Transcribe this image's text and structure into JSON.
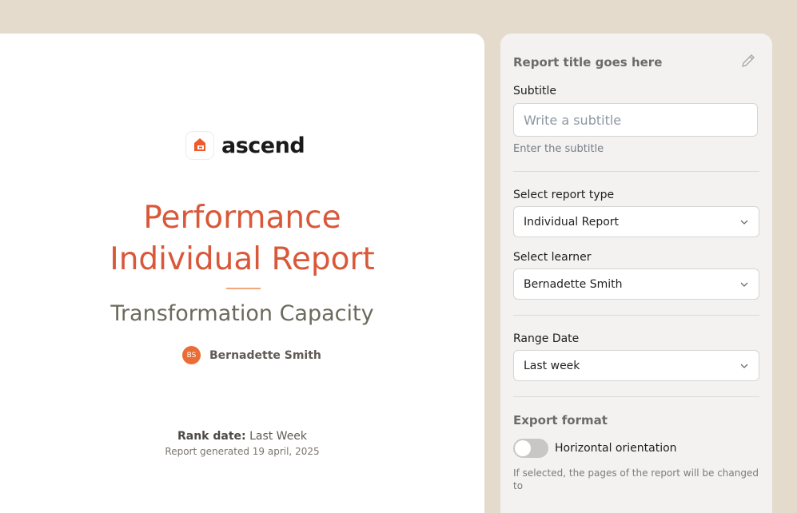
{
  "preview": {
    "logo_text": "ascend",
    "title_line1": "Performance",
    "title_line2": "Individual Report",
    "subject": "Transformation Capacity",
    "learner_initials": "BS",
    "learner_name": "Bernadette Smith",
    "rank_label": "Rank date:",
    "rank_value": "Last Week",
    "generated": "Report generated 19 april, 2025"
  },
  "panel": {
    "title": "Report title goes here",
    "subtitle_label": "Subtitle",
    "subtitle_placeholder": "Write a subtitle",
    "subtitle_helper": "Enter the subtitle",
    "report_type_label": "Select report type",
    "report_type_value": "Individual Report",
    "learner_label": "Select learner",
    "learner_value": "Bernadette Smith",
    "range_label": "Range Date",
    "range_value": "Last week",
    "export_title": "Export format",
    "orientation_label": "Horizontal orientation",
    "orientation_enabled": false,
    "orientation_help": "If selected, the pages of the report will be changed to"
  },
  "colors": {
    "background": "#e5dbcd",
    "accent": "#d9583a",
    "avatar": "#ea6d35"
  }
}
